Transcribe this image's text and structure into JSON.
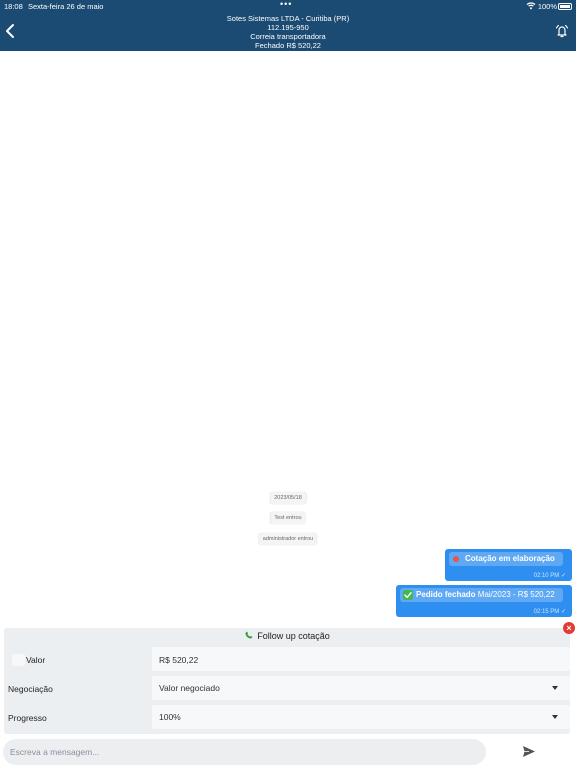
{
  "status_bar": {
    "time": "18:08",
    "date": "Sexta-feira 26 de maio",
    "dots": "•••",
    "battery_pct": "100%"
  },
  "header": {
    "line1": "Sotes Sistemas LTDA - Curitiba (PR)",
    "line2": "112.195-950",
    "line3": "Correia transportadora",
    "line4": "Fechado R$ 520,22",
    "back_icon": "chevron-left-icon",
    "notify_icon": "bell-alert-icon"
  },
  "chat": {
    "chips": [
      "2023/05/18",
      "Test entrou",
      "administrador entrou"
    ],
    "messages": [
      {
        "status_icon": "red-dot-icon",
        "text_bold": "Cotação em elaboração",
        "text_rest": "",
        "time": "02:10 PM ✓"
      },
      {
        "status_icon": "green-check-icon",
        "text_bold": "Pedido fechado",
        "text_rest": " Mai/2023 - R$ 520,22",
        "time": "02:15 PM ✓"
      }
    ]
  },
  "follow_up": {
    "title": "Follow up cotação",
    "title_icon": "phone-icon",
    "valor_label": "Valor",
    "valor_value": "R$ 520,22",
    "negociacao_label": "Negociação",
    "negociacao_value": "Valor negociado",
    "progresso_label": "Progresso",
    "progresso_value": "100%",
    "close_label": "×"
  },
  "composer": {
    "placeholder": "Escreva a mensagem..."
  },
  "colors": {
    "header_bg": "#1b4b72",
    "bubble_bg": "#2f8ff0",
    "bubble_inner": "#5fa9f4",
    "close_red": "#e53935"
  }
}
